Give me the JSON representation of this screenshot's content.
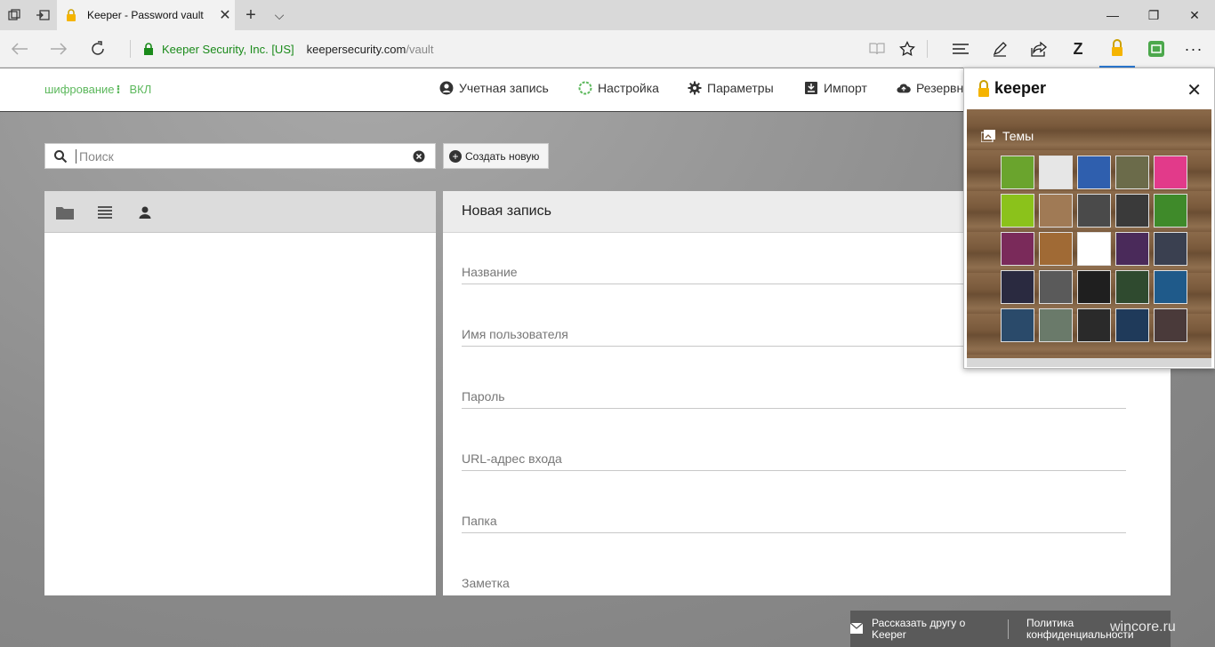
{
  "browser": {
    "tab_title": "Keeper - Password vault",
    "tab_close": "✕",
    "new_tab": "+",
    "tab_list": "⌵",
    "win_min": "—",
    "win_max": "❐",
    "win_close": "✕",
    "url_org": "Keeper Security, Inc. [US]",
    "url_host": "keepersecurity.com",
    "url_path": "/vault",
    "toolbar_z": "Z",
    "toolbar_more": "···"
  },
  "topnav": {
    "encryption_label": "шифрование",
    "encryption_value": "ВКЛ",
    "items": [
      {
        "label": "Учетная запись"
      },
      {
        "label": "Настройка"
      },
      {
        "label": "Параметры"
      },
      {
        "label": "Импорт"
      },
      {
        "label": "Резервн"
      }
    ]
  },
  "search": {
    "placeholder": "Поиск"
  },
  "create_button": {
    "label": "Создать новую"
  },
  "record": {
    "title": "Новая запись",
    "fields": [
      "Название",
      "Имя пользователя",
      "Пароль",
      "URL-адрес входа",
      "Папка",
      "Заметка"
    ]
  },
  "footer": {
    "tell_friend": "Рассказать другу о Keeper",
    "privacy": "Политика конфиденциальности"
  },
  "watermark": "wincore.ru",
  "popup": {
    "brand": "keeper",
    "close": "✕",
    "themes_label": "Темы",
    "swatches": [
      "#6aa42d",
      "#e6e6e6",
      "#2f5fae",
      "#6b6b4a",
      "#e23a8a",
      "#8bc21b",
      "#a07a55",
      "#4a4a4a",
      "#3a3a3a",
      "#3f8a2a",
      "#7a2a5a",
      "#a06a35",
      "#ffffff",
      "#4a2a5a",
      "#3a4050",
      "#2a2a40",
      "#5a5a5a",
      "#1f1f1f",
      "#2f4a2f",
      "#1f5a8a",
      "#2a4a6a",
      "#6a7a6a",
      "#2a2a2a",
      "#1f3a5a",
      "#4a3a3a"
    ]
  },
  "colors": {
    "accent_green": "#5cb85c",
    "secure_green": "#1a8a1a",
    "keeper_yellow": "#f5b400"
  }
}
